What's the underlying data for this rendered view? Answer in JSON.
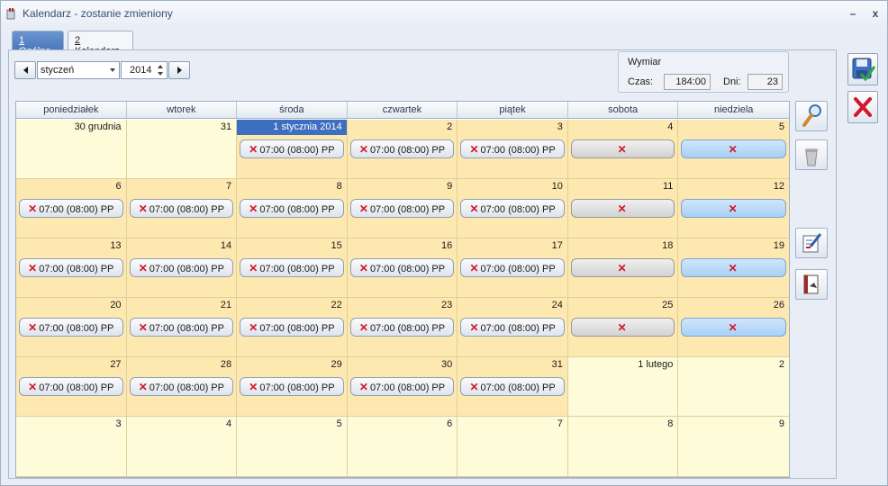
{
  "window": {
    "title": "Kalendarz - zostanie zmieniony",
    "minimize_label": "–",
    "close_label": "x"
  },
  "tabs": [
    {
      "key": "1",
      "label": " Ogólne",
      "active": true
    },
    {
      "key": "2",
      "label": " Kalendarz",
      "active": false
    }
  ],
  "nav": {
    "month": "styczeń",
    "year": "2014"
  },
  "wymiar": {
    "title": "Wymiar",
    "czas_label": "Czas:",
    "czas_value": "184:00",
    "dni_label": "Dni:",
    "dni_value": "23"
  },
  "calendar": {
    "weekdays": [
      "poniedziałek",
      "wtorek",
      "środa",
      "czwartek",
      "piątek",
      "sobota",
      "niedziela"
    ],
    "chip_text": "07:00 (08:00) PP",
    "days": [
      {
        "label": "30 grudnia",
        "in": false,
        "chip": "none"
      },
      {
        "label": "31",
        "in": false,
        "chip": "none"
      },
      {
        "label": "1 stycznia 2014",
        "in": true,
        "today": true,
        "chip": "work"
      },
      {
        "label": "2",
        "in": true,
        "chip": "work"
      },
      {
        "label": "3",
        "in": true,
        "chip": "work"
      },
      {
        "label": "4",
        "in": true,
        "chip": "sat"
      },
      {
        "label": "5",
        "in": true,
        "chip": "sun"
      },
      {
        "label": "6",
        "in": true,
        "chip": "work"
      },
      {
        "label": "7",
        "in": true,
        "chip": "work"
      },
      {
        "label": "8",
        "in": true,
        "chip": "work"
      },
      {
        "label": "9",
        "in": true,
        "chip": "work"
      },
      {
        "label": "10",
        "in": true,
        "chip": "work"
      },
      {
        "label": "11",
        "in": true,
        "chip": "sat"
      },
      {
        "label": "12",
        "in": true,
        "chip": "sun"
      },
      {
        "label": "13",
        "in": true,
        "chip": "work"
      },
      {
        "label": "14",
        "in": true,
        "chip": "work"
      },
      {
        "label": "15",
        "in": true,
        "chip": "work"
      },
      {
        "label": "16",
        "in": true,
        "chip": "work"
      },
      {
        "label": "17",
        "in": true,
        "chip": "work"
      },
      {
        "label": "18",
        "in": true,
        "chip": "sat"
      },
      {
        "label": "19",
        "in": true,
        "chip": "sun"
      },
      {
        "label": "20",
        "in": true,
        "chip": "work"
      },
      {
        "label": "21",
        "in": true,
        "chip": "work"
      },
      {
        "label": "22",
        "in": true,
        "chip": "work"
      },
      {
        "label": "23",
        "in": true,
        "chip": "work"
      },
      {
        "label": "24",
        "in": true,
        "chip": "work"
      },
      {
        "label": "25",
        "in": true,
        "chip": "sat"
      },
      {
        "label": "26",
        "in": true,
        "chip": "sun"
      },
      {
        "label": "27",
        "in": true,
        "chip": "work"
      },
      {
        "label": "28",
        "in": true,
        "chip": "work"
      },
      {
        "label": "29",
        "in": true,
        "chip": "work"
      },
      {
        "label": "30",
        "in": true,
        "chip": "work"
      },
      {
        "label": "31",
        "in": true,
        "chip": "work"
      },
      {
        "label": "1 lutego",
        "in": false,
        "chip": "none"
      },
      {
        "label": "2",
        "in": false,
        "chip": "none"
      },
      {
        "label": "3",
        "in": false,
        "chip": "none"
      },
      {
        "label": "4",
        "in": false,
        "chip": "none"
      },
      {
        "label": "5",
        "in": false,
        "chip": "none"
      },
      {
        "label": "6",
        "in": false,
        "chip": "none"
      },
      {
        "label": "7",
        "in": false,
        "chip": "none"
      },
      {
        "label": "8",
        "in": false,
        "chip": "none"
      },
      {
        "label": "9",
        "in": false,
        "chip": "none"
      }
    ]
  },
  "tools": {
    "icons": [
      "magnifier-icon",
      "trash-icon",
      "edit-schedule-icon",
      "report-icon"
    ]
  },
  "actions": {
    "icons": [
      "save-icon",
      "cancel-icon"
    ]
  },
  "colors": {
    "in_month": "#fde8b0",
    "out_month": "#fefbd9",
    "today": "#3d6fc1",
    "x_mark": "#d1172a",
    "sunday_chip": "#a8d0f5",
    "saturday_chip": "#d2d2d2"
  }
}
